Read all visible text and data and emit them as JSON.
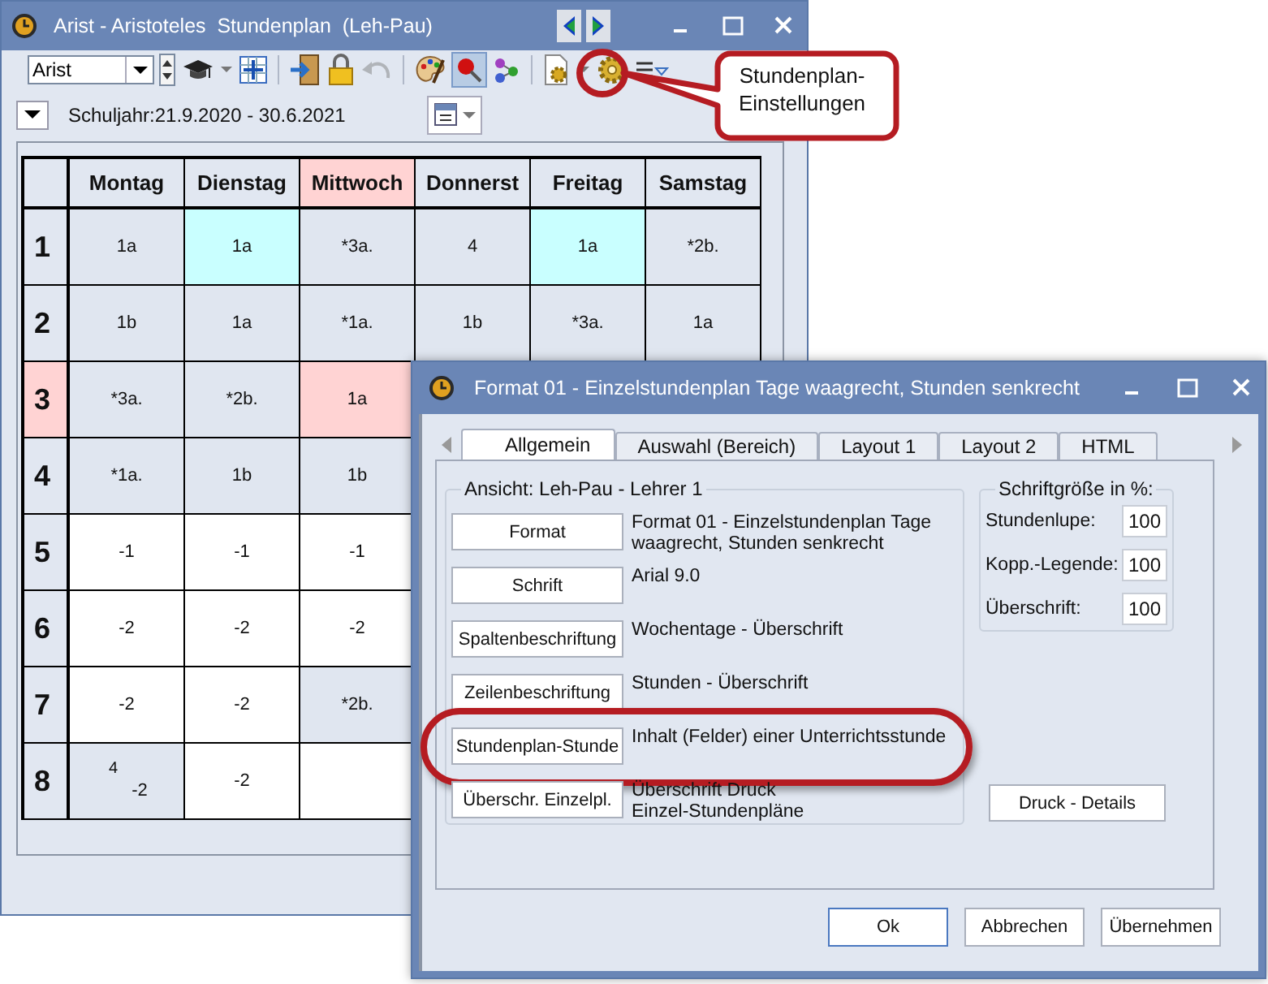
{
  "main_window": {
    "title": "Arist - Aristoteles  Stundenplan  (Leh-Pau)",
    "element_combo": {
      "value": "Arist"
    },
    "tool_groups": [
      [
        {
          "kind": "spinner",
          "selected": false,
          "disabled": false
        },
        {
          "kind": "hat",
          "selected": false,
          "disabled": false
        },
        {
          "kind": "menu_caret",
          "selected": false,
          "disabled": false
        },
        {
          "kind": "grid",
          "selected": false,
          "disabled": false
        }
      ],
      [
        {
          "kind": "enter",
          "selected": false,
          "disabled": false
        },
        {
          "kind": "lock",
          "selected": false,
          "disabled": false
        },
        {
          "kind": "undo",
          "selected": false,
          "disabled": true
        }
      ],
      [
        {
          "kind": "palette",
          "selected": false,
          "disabled": false
        },
        {
          "kind": "pin",
          "selected": true,
          "disabled": false
        },
        {
          "kind": "nodes",
          "selected": false,
          "disabled": false
        }
      ],
      [
        {
          "kind": "page_gear",
          "selected": false,
          "disabled": false
        },
        {
          "kind": "menu_caret",
          "selected": false,
          "disabled": false
        },
        {
          "kind": "gear",
          "selected": false,
          "disabled": false
        },
        {
          "kind": "list_menu",
          "selected": false,
          "disabled": false
        }
      ]
    ],
    "school_year": "Schuljahr:21.9.2020 - 30.6.2021",
    "timetable": {
      "columns": [
        {
          "label": "Montag",
          "highlighted": false
        },
        {
          "label": "Dienstag",
          "highlighted": false
        },
        {
          "label": "Mittwoch",
          "highlighted": true
        },
        {
          "label": "Donnerst",
          "highlighted": false
        },
        {
          "label": "Freitag",
          "highlighted": false
        },
        {
          "label": "Samstag",
          "highlighted": false
        }
      ],
      "rows": [
        {
          "label": "1",
          "highlighted": false,
          "cells": [
            {
              "text": "1a",
              "color": "#e0e6f0"
            },
            {
              "text": "1a",
              "color": "#c9ffff"
            },
            {
              "text": "*3a.",
              "color": "#e0e6f0"
            },
            {
              "text": "4",
              "color": "#e0e6f0"
            },
            {
              "text": "1a",
              "color": "#c9ffff"
            },
            {
              "text": "*2b.",
              "color": "#e0e6f0"
            }
          ]
        },
        {
          "label": "2",
          "highlighted": false,
          "cells": [
            {
              "text": "1b",
              "color": "#e0e6f0"
            },
            {
              "text": "1a",
              "color": "#e0e6f0"
            },
            {
              "text": "*1a.",
              "color": "#e0e6f0"
            },
            {
              "text": "1b",
              "color": "#e0e6f0"
            },
            {
              "text": "*3a.",
              "color": "#e0e6f0"
            },
            {
              "text": "1a",
              "color": "#e0e6f0"
            }
          ]
        },
        {
          "label": "3",
          "highlighted": true,
          "cells": [
            {
              "text": "*3a.",
              "color": "#e0e6f0"
            },
            {
              "text": "*2b.",
              "color": "#e0e6f0"
            },
            {
              "text": "1a",
              "color": "#ffd3d3"
            }
          ]
        },
        {
          "label": "4",
          "highlighted": false,
          "cells": [
            {
              "text": "*1a.",
              "color": "#e0e6f0"
            },
            {
              "text": "1b",
              "color": "#e0e6f0"
            },
            {
              "text": "1b",
              "color": "#e0e6f0"
            }
          ]
        },
        {
          "label": "5",
          "highlighted": false,
          "cells": [
            {
              "text": "-1",
              "color": "#ffffff"
            },
            {
              "text": "-1",
              "color": "#ffffff"
            },
            {
              "text": "-1",
              "color": "#ffffff"
            }
          ]
        },
        {
          "label": "6",
          "highlighted": false,
          "cells": [
            {
              "text": "-2",
              "color": "#ffffff"
            },
            {
              "text": "-2",
              "color": "#ffffff"
            },
            {
              "text": "-2",
              "color": "#ffffff"
            }
          ]
        },
        {
          "label": "7",
          "highlighted": false,
          "cells": [
            {
              "text": "-2",
              "color": "#ffffff"
            },
            {
              "text": "-2",
              "color": "#ffffff"
            },
            {
              "text": "*2b.",
              "color": "#e0e6f0"
            }
          ]
        },
        {
          "label": "8",
          "highlighted": false,
          "cells": [
            {
              "note": "4",
              "text": "-2",
              "color": "#e0e6f0"
            },
            {
              "text": "-2",
              "color": "#ffffff"
            },
            {
              "color": "#ffffff"
            }
          ]
        }
      ]
    }
  },
  "callout": {
    "text": "Stundenplan-Einstellungen"
  },
  "dialog": {
    "title": "Format 01 - Einzelstundenplan Tage waagrecht, Stunden senkrecht",
    "tabs": [
      {
        "label": "Allgemein",
        "selected": true
      },
      {
        "label": "Auswahl (Bereich)",
        "selected": false
      },
      {
        "label": "Layout 1",
        "selected": false
      },
      {
        "label": "Layout 2",
        "selected": false
      },
      {
        "label": "HTML",
        "selected": false
      }
    ],
    "view_group": {
      "title": "Ansicht: Leh-Pau - Lehrer 1",
      "items": [
        {
          "button": "Format",
          "description": [
            "Format 01 - Einzelstundenplan Tage",
            "waagrecht, Stunden senkrecht"
          ],
          "highlighted": false
        },
        {
          "button": "Schrift",
          "description": [
            "Arial 9.0"
          ],
          "highlighted": false
        },
        {
          "button": "Spaltenbeschriftung",
          "description": [
            "Wochentage - Überschrift"
          ],
          "highlighted": false
        },
        {
          "button": "Zeilenbeschriftung",
          "description": [
            "Stunden - Überschrift"
          ],
          "highlighted": false
        },
        {
          "button": "Stundenplan-Stunde",
          "description": [
            "Inhalt (Felder) einer Unterrichtsstunde"
          ],
          "highlighted": true
        },
        {
          "button": "Überschr. Einzelpl.",
          "description": [
            "Überschrift Druck",
            "Einzel-Stundenpläne"
          ],
          "highlighted": false
        }
      ]
    },
    "font_size_group": {
      "title": "Schriftgröße in %:",
      "fields": [
        {
          "label": "Stundenlupe:",
          "value": "100"
        },
        {
          "label": "Kopp.-Legende:",
          "value": "100"
        },
        {
          "label": "Überschrift:",
          "value": "100"
        }
      ]
    },
    "details_button": "Druck - Details",
    "buttons": [
      {
        "label": "Ok",
        "default": true
      },
      {
        "label": "Abbrechen",
        "default": false
      },
      {
        "label": "Übernehmen",
        "default": false
      }
    ]
  }
}
